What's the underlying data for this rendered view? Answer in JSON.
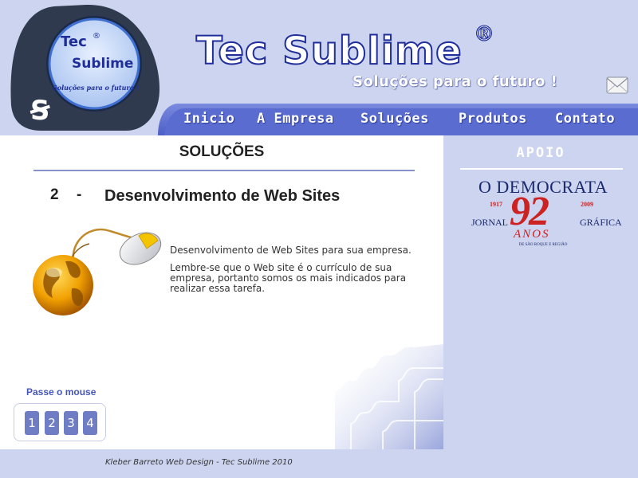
{
  "logo": {
    "line1": "Tec",
    "reg": "®",
    "line2": "Sublime",
    "tagline": "Soluções para o futuro !",
    "monogram": "TS"
  },
  "header": {
    "title": "Tec Sublime",
    "reg_mark": "®",
    "slogan": "Soluções para o futuro !",
    "mail_icon": "envelope-icon"
  },
  "nav": {
    "items": [
      {
        "label": "Inicio"
      },
      {
        "label": "A Empresa"
      },
      {
        "label": "Soluções"
      },
      {
        "label": "Produtos"
      },
      {
        "label": "Contato"
      }
    ]
  },
  "main": {
    "section_title": "SOLUÇÕES",
    "item_number": "2",
    "item_dash": "-",
    "item_title": "Desenvolvimento de Web Sites",
    "paragraphs": [
      "Desenvolvimento de Web Sites para sua empresa.",
      "Lembre-se que o Web site é o currículo de sua empresa, portanto somos os mais indicados para realizar essa tarefa."
    ],
    "hover_label": "Passe o mouse",
    "pages": [
      "1",
      "2",
      "3",
      "4"
    ]
  },
  "sidebar": {
    "heading": "APOIO",
    "ad": {
      "paper": "O DEMOCRATA",
      "year_start": "1917",
      "year_end": "2009",
      "big_number": "92",
      "left_word": "JORNAL",
      "right_word": "GRÁFICA",
      "anos": "ANOS",
      "sub": "DE SÃO ROQUE E REGIÃO"
    }
  },
  "footer": {
    "text": "Kleber Barreto Web Design - Tec Sublime 2010"
  },
  "colors": {
    "page_bg": "#cdd4ef",
    "nav_bg": "#5a6cd0",
    "title_outline": "#1f2e9a",
    "accent": "#4556b8"
  }
}
